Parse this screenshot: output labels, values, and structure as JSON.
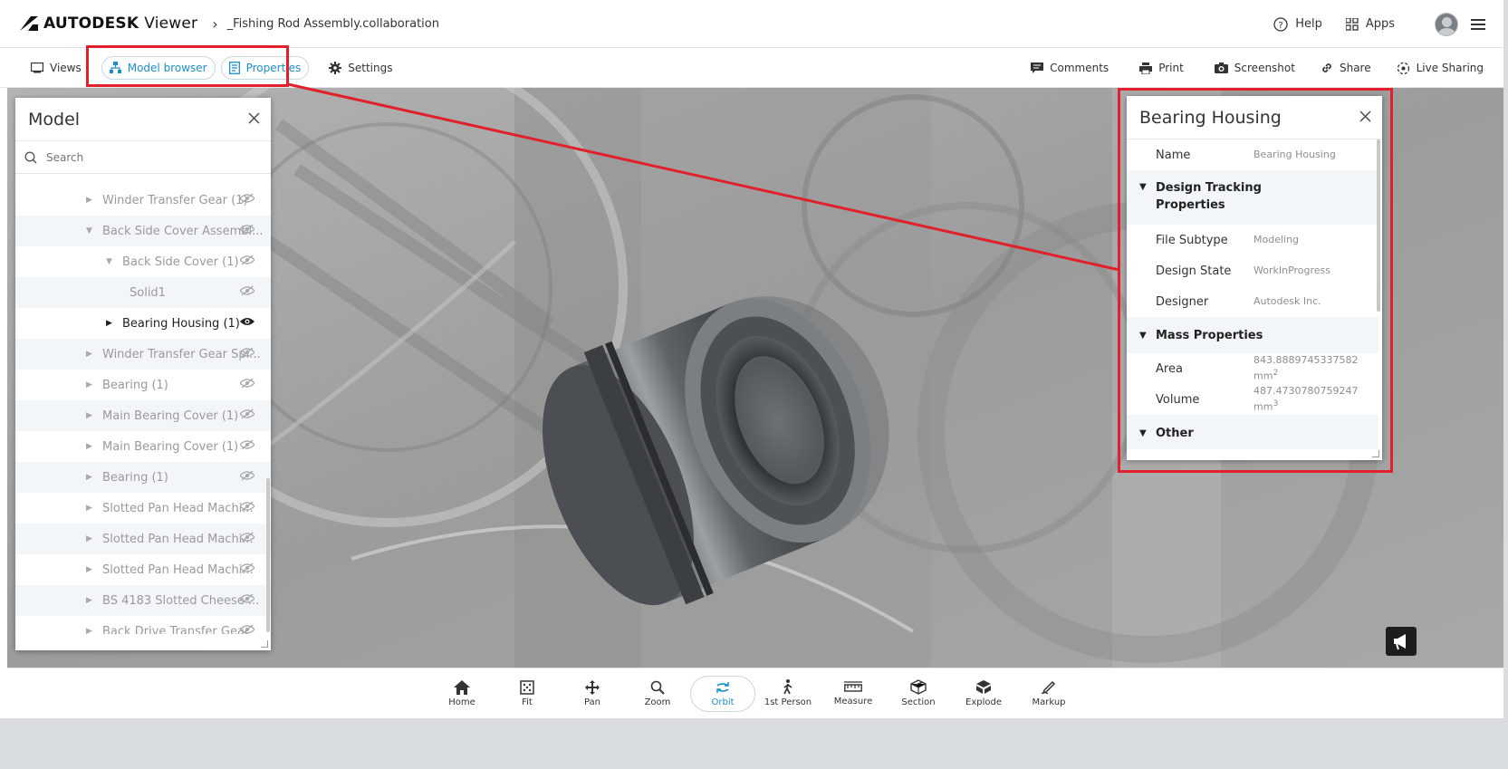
{
  "header": {
    "brand": "AUTODESK",
    "product": "Viewer",
    "breadcrumb": "_Fishing Rod Assembly.collaboration",
    "help_label": "Help",
    "apps_label": "Apps"
  },
  "toolbar": {
    "views": "Views",
    "model_browser": "Model browser",
    "properties": "Properties",
    "settings": "Settings",
    "comments": "Comments",
    "print": "Print",
    "screenshot": "Screenshot",
    "share": "Share",
    "live_sharing": "Live Sharing"
  },
  "model_panel": {
    "title": "Model",
    "search_placeholder": "Search",
    "items": [
      {
        "label": "Winder Transfer Gear (1)",
        "indent": 0,
        "state": "collapsed"
      },
      {
        "label": "Back Side Cover Assembl...",
        "indent": 0,
        "state": "expanded"
      },
      {
        "label": "Back Side Cover (1)",
        "indent": 1,
        "state": "expanded"
      },
      {
        "label": "Solid1",
        "indent": 2,
        "state": "leaf"
      },
      {
        "label": "Bearing Housing (1)",
        "indent": 1,
        "state": "collapsed",
        "selected": true
      },
      {
        "label": "Winder Transfer Gear Spi...",
        "indent": 0,
        "state": "collapsed"
      },
      {
        "label": "Bearing (1)",
        "indent": 0,
        "state": "collapsed"
      },
      {
        "label": "Main Bearing Cover (1)",
        "indent": 0,
        "state": "collapsed"
      },
      {
        "label": "Main Bearing Cover (1)",
        "indent": 0,
        "state": "collapsed"
      },
      {
        "label": "Bearing (1)",
        "indent": 0,
        "state": "collapsed"
      },
      {
        "label": "Slotted Pan Head Machi...",
        "indent": 0,
        "state": "collapsed"
      },
      {
        "label": "Slotted Pan Head Machi...",
        "indent": 0,
        "state": "collapsed"
      },
      {
        "label": "Slotted Pan Head Machi...",
        "indent": 0,
        "state": "collapsed"
      },
      {
        "label": "BS 4183 Slotted Cheese ...",
        "indent": 0,
        "state": "collapsed"
      },
      {
        "label": "Back Drive Transfer Gear",
        "indent": 0,
        "state": "collapsed"
      }
    ]
  },
  "properties_panel": {
    "title": "Bearing Housing",
    "name_label": "Name",
    "name_value": "Bearing Housing",
    "design_tracking": "Design Tracking Properties",
    "file_subtype_label": "File Subtype",
    "file_subtype_value": "Modeling",
    "design_state_label": "Design State",
    "design_state_value": "WorkInProgress",
    "designer_label": "Designer",
    "designer_value": "Autodesk Inc.",
    "mass_properties": "Mass Properties",
    "area_label": "Area",
    "area_value": "843.8889745337582",
    "area_unit": "mm",
    "area_exp": "2",
    "volume_label": "Volume",
    "volume_value": "487.4730780759247",
    "volume_unit": "mm",
    "volume_exp": "3",
    "other": "Other"
  },
  "bottom_toolbar": {
    "home": "Home",
    "fit": "Fit",
    "pan": "Pan",
    "zoom": "Zoom",
    "orbit": "Orbit",
    "first_person": "1st Person",
    "measure": "Measure",
    "section": "Section",
    "explode": "Explode",
    "markup": "Markup"
  },
  "colors": {
    "accent": "#1a8fc9",
    "highlight": "#e0202a"
  }
}
